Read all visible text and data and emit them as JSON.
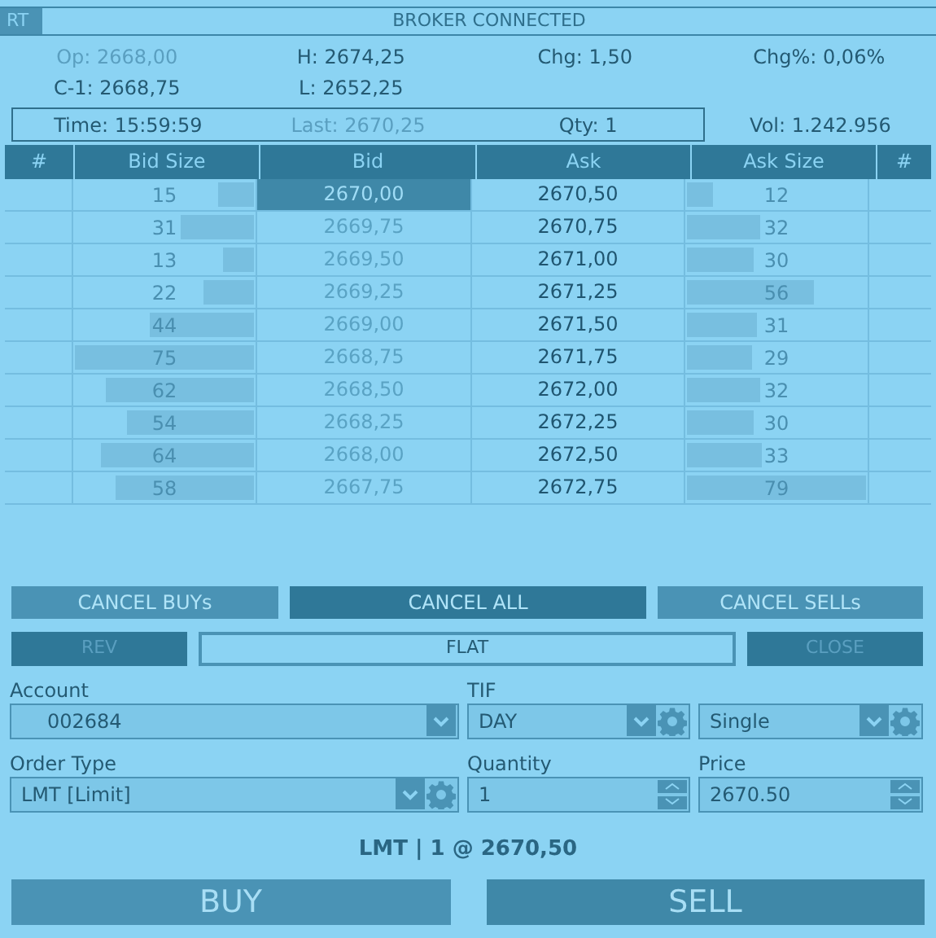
{
  "status_bar": {
    "tag": "RT",
    "text": "BROKER CONNECTED"
  },
  "stats": [
    {
      "text": "Op: 2668,00",
      "dimmed": true
    },
    {
      "text": "H: 2674,25",
      "dimmed": false
    },
    {
      "text": "Chg: 1,50",
      "dimmed": false
    },
    {
      "text": "Chg%: 0,06%",
      "dimmed": false
    },
    {
      "text": "C-1: 2668,75",
      "dimmed": false
    },
    {
      "text": "L: 2652,25",
      "dimmed": false
    }
  ],
  "last_trade": [
    {
      "text": "Time: 15:59:59",
      "dimmed": false
    },
    {
      "text": "Last: 2670,25",
      "dimmed": true
    },
    {
      "text": "Qty: 1",
      "dimmed": false
    }
  ],
  "volume": "Vol: 1.242.956",
  "table": {
    "columns": [
      "#",
      "Bid Size",
      "Bid",
      "Ask",
      "Ask Size",
      "#"
    ],
    "rows": [
      {
        "bid_size": {
          "text": "15",
          "level": 0.2
        },
        "bid": "2670,00",
        "selected": true,
        "ask": "2670,50",
        "ask_size": {
          "text": "12",
          "level": 0.14
        }
      },
      {
        "bid_size": {
          "text": "31",
          "level": 0.4
        },
        "bid": "2669,75",
        "selected": false,
        "ask": "2670,75",
        "ask_size": {
          "text": "32",
          "level": 0.4
        }
      },
      {
        "bid_size": {
          "text": "13",
          "level": 0.17
        },
        "bid": "2669,50",
        "selected": false,
        "ask": "2671,00",
        "ask_size": {
          "text": "30",
          "level": 0.37
        }
      },
      {
        "bid_size": {
          "text": "22",
          "level": 0.28
        },
        "bid": "2669,25",
        "selected": false,
        "ask": "2671,25",
        "ask_size": {
          "text": "56",
          "level": 0.7
        }
      },
      {
        "bid_size": {
          "text": "44",
          "level": 0.57
        },
        "bid": "2669,00",
        "selected": false,
        "ask": "2671,50",
        "ask_size": {
          "text": "31",
          "level": 0.38
        }
      },
      {
        "bid_size": {
          "text": "75",
          "level": 0.98
        },
        "bid": "2668,75",
        "selected": false,
        "ask": "2671,75",
        "ask_size": {
          "text": "29",
          "level": 0.36
        }
      },
      {
        "bid_size": {
          "text": "62",
          "level": 0.81
        },
        "bid": "2668,50",
        "selected": false,
        "ask": "2672,00",
        "ask_size": {
          "text": "32",
          "level": 0.4
        }
      },
      {
        "bid_size": {
          "text": "54",
          "level": 0.7
        },
        "bid": "2668,25",
        "selected": false,
        "ask": "2672,25",
        "ask_size": {
          "text": "30",
          "level": 0.37
        }
      },
      {
        "bid_size": {
          "text": "64",
          "level": 0.84
        },
        "bid": "2668,00",
        "selected": false,
        "ask": "2672,50",
        "ask_size": {
          "text": "33",
          "level": 0.41
        }
      },
      {
        "bid_size": {
          "text": "58",
          "level": 0.76
        },
        "bid": "2667,75",
        "selected": false,
        "ask": "2672,75",
        "ask_size": {
          "text": "79",
          "level": 0.98
        }
      }
    ]
  },
  "cancel_buttons": [
    {
      "label": "CANCEL BUYs",
      "kind": "mid"
    },
    {
      "label": "CANCEL ALL",
      "kind": "dark"
    },
    {
      "label": "CANCEL SELLs",
      "kind": "mid"
    }
  ],
  "position_buttons": [
    {
      "label": "REV",
      "kind": "dark",
      "disabled": true
    },
    {
      "label": "FLAT",
      "kind": "outline",
      "disabled": false
    },
    {
      "label": "CLOSE",
      "kind": "dark",
      "disabled": true
    }
  ],
  "account": {
    "label": "Account",
    "value": "002684"
  },
  "tif": {
    "label": "TIF",
    "value": "DAY"
  },
  "order_mode": {
    "value": "Single"
  },
  "order_type": {
    "label": "Order Type",
    "value": "LMT [Limit]"
  },
  "quantity": {
    "label": "Quantity",
    "value": "1"
  },
  "price": {
    "label": "Price",
    "value": "2670.50"
  },
  "summary": "LMT | 1 @ 2670,50",
  "buy_button": "BUY",
  "sell_button": "SELL"
}
